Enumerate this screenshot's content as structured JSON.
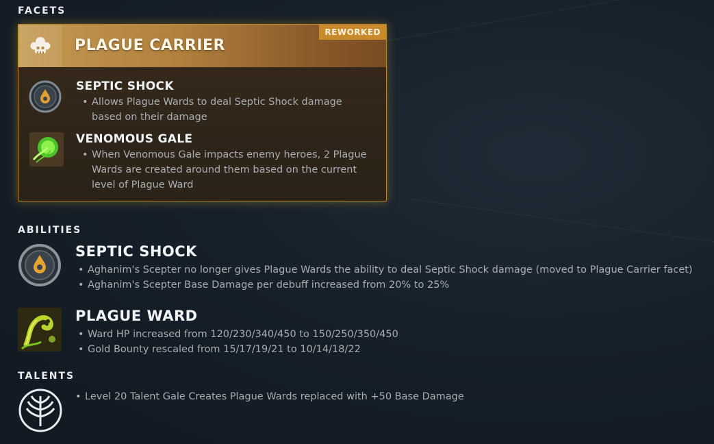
{
  "facets": {
    "section_title": "FACETS",
    "card": {
      "name": "PLAGUE CARRIER",
      "badge": "REWORKED",
      "icon": "skull-helmet-icon",
      "colors": {
        "header_start": "#c49a52",
        "header_end": "#7a4c24",
        "border": "#b5882e",
        "badge": "#c98a2c"
      },
      "abilities": [
        {
          "name": "SEPTIC SHOCK",
          "icon": "septic-shock-icon",
          "notes": [
            "Allows Plague Wards to deal Septic Shock damage based on their damage"
          ]
        },
        {
          "name": "VENOMOUS GALE",
          "icon": "venomous-gale-icon",
          "notes": [
            "When Venomous Gale impacts enemy heroes, 2 Plague Wards are created around them based on the current level of Plague Ward"
          ]
        }
      ]
    }
  },
  "abilities": {
    "section_title": "ABILITIES",
    "items": [
      {
        "name": "SEPTIC SHOCK",
        "icon": "septic-shock-icon",
        "notes": [
          "Aghanim's Scepter no longer gives Plague Wards the ability to deal Septic Shock damage (moved to Plague Carrier facet)",
          "Aghanim's Scepter Base Damage per debuff increased from 20% to 25%"
        ]
      },
      {
        "name": "PLAGUE WARD",
        "icon": "plague-ward-icon",
        "notes": [
          "Ward HP increased from 120/230/340/450 to 150/250/350/450",
          "Gold Bounty rescaled from 15/17/19/21 to 10/14/18/22"
        ]
      }
    ]
  },
  "talents": {
    "section_title": "TALENTS",
    "icon": "talent-tree-icon",
    "notes": [
      "Level 20 Talent Gale Creates Plague Wards replaced with +50 Base Damage"
    ]
  }
}
